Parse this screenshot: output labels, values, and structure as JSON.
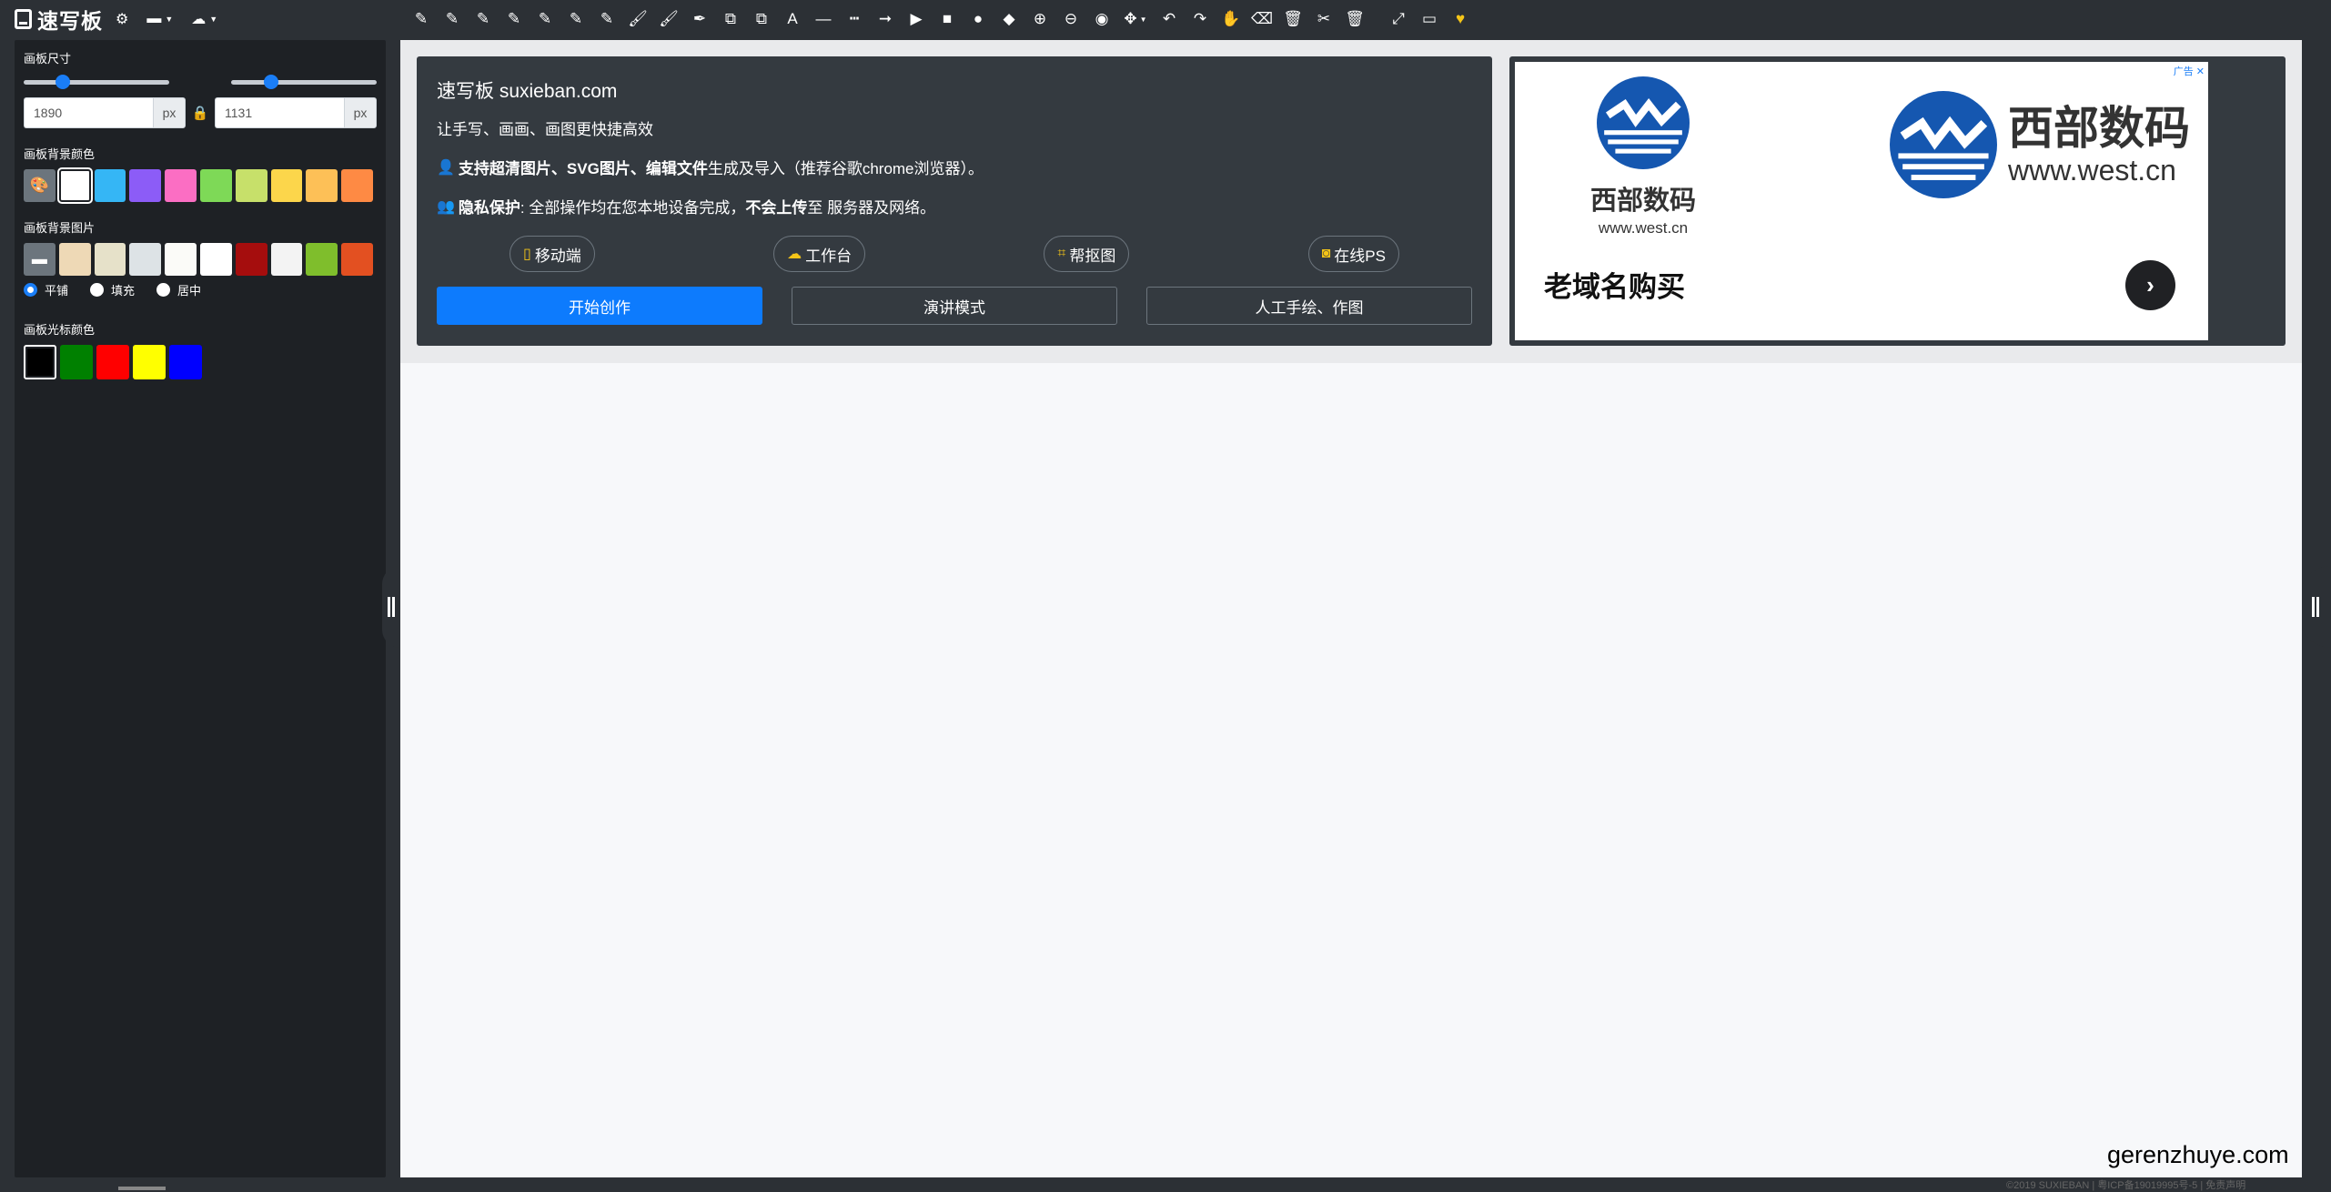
{
  "app": {
    "name": "速写板"
  },
  "top_menu": [
    {
      "icon": "gear-icon",
      "glyph": "⚙",
      "has_caret": false
    },
    {
      "icon": "folder-open-icon",
      "glyph": "▬",
      "has_caret": true
    },
    {
      "icon": "cloud-upload-icon",
      "glyph": "☁",
      "has_caret": true
    }
  ],
  "toolbar": [
    {
      "name": "pencil-1-icon",
      "glyph": "✎"
    },
    {
      "name": "pencil-2-icon",
      "glyph": "✎"
    },
    {
      "name": "pencil-3-icon",
      "glyph": "✎"
    },
    {
      "name": "pencil-4-icon",
      "glyph": "✎"
    },
    {
      "name": "pencil-5-icon",
      "glyph": "✎"
    },
    {
      "name": "pencil-6-icon",
      "glyph": "✎"
    },
    {
      "name": "pencil-7-icon",
      "glyph": "✎"
    },
    {
      "name": "brush-1-icon",
      "glyph": "🖌"
    },
    {
      "name": "brush-2-icon",
      "glyph": "🖌"
    },
    {
      "name": "marker-icon",
      "glyph": "✒"
    },
    {
      "name": "shapes-icon",
      "glyph": "⧉"
    },
    {
      "name": "shapes-alt-icon",
      "glyph": "⧉"
    },
    {
      "name": "text-icon",
      "glyph": "A"
    },
    {
      "name": "line-icon",
      "glyph": "—"
    },
    {
      "name": "dashed-line-icon",
      "glyph": "┅"
    },
    {
      "name": "arrow-line-icon",
      "glyph": "➞"
    },
    {
      "name": "triangle-icon",
      "glyph": "▶"
    },
    {
      "name": "square-icon",
      "glyph": "■"
    },
    {
      "name": "circle-icon",
      "glyph": "●"
    },
    {
      "name": "shapes-group-icon",
      "glyph": "◆"
    },
    {
      "name": "zoom-in-icon",
      "glyph": "⊕"
    },
    {
      "name": "zoom-out-icon",
      "glyph": "⊖"
    },
    {
      "name": "target-icon",
      "glyph": "◉"
    },
    {
      "name": "move-icon",
      "glyph": "✥",
      "caret": true
    },
    {
      "name": "undo-icon",
      "glyph": "↶"
    },
    {
      "name": "redo-icon",
      "glyph": "↷"
    },
    {
      "name": "hand-icon",
      "glyph": "✋"
    },
    {
      "name": "eraser-icon",
      "glyph": "⌫"
    },
    {
      "name": "trash-icon",
      "glyph": "🗑"
    },
    {
      "name": "scissors-icon",
      "glyph": "✂"
    },
    {
      "name": "trash-all-icon",
      "glyph": "🗑"
    },
    {
      "name": "fullscreen-icon",
      "glyph": "⤢",
      "gap": true
    },
    {
      "name": "presentation-icon",
      "glyph": "▭"
    },
    {
      "name": "heart-icon",
      "glyph": "♥",
      "heart": true
    }
  ],
  "left_panel": {
    "size_label": "画板尺寸",
    "width_value": "1890",
    "height_value": "1131",
    "unit": "px",
    "width_slider": 0.24,
    "height_slider": 0.25,
    "bg_color_label": "画板背景颜色",
    "bg_colors": [
      "#ffffff",
      "#35b6f5",
      "#8c5cf7",
      "#fb6ec3",
      "#7ed957",
      "#c7e06a",
      "#fcd64b",
      "#fdc057",
      "#fe8a44"
    ],
    "bg_image_label": "画板背景图片",
    "bg_images": [
      "#eed9b6",
      "#e6e1c9",
      "#dde3e6",
      "#fbfbf8",
      "#ffffff",
      "#a50d0d",
      "#f3f3f3",
      "#7fbe2c",
      "#e35021"
    ],
    "fill_modes": [
      "平铺",
      "填充",
      "居中"
    ],
    "fill_selected": 0,
    "cursor_color_label": "画板光标颜色",
    "cursor_colors": [
      "#000000",
      "#008000",
      "#ff0000",
      "#ffff00",
      "#0000ff"
    ]
  },
  "hero": {
    "title": "速写板 suxieban.com",
    "subtitle": "让手写、画画、画图更快捷高效",
    "line2_bold_1": "支持超清图片、SVG图片、编辑文件",
    "line2_rest": "生成及导入（推荐谷歌chrome浏览器）。",
    "line3_bold_1": "隐私保护",
    "line3_mid": ": 全部操作均在您本地设备完成，",
    "line3_bold_2": "不会上传",
    "line3_rest": " 至 服务器及网络。",
    "pills": [
      {
        "label": "移动端",
        "icon": "tablet-icon",
        "glyph": "▯"
      },
      {
        "label": "工作台",
        "icon": "cloud-icon",
        "glyph": "☁"
      },
      {
        "label": "帮抠图",
        "icon": "crop-icon",
        "glyph": "⌗"
      },
      {
        "label": "在线PS",
        "icon": "camera-icon",
        "glyph": "◙"
      }
    ],
    "buttons": [
      "开始创作",
      "演讲模式",
      "人工手绘、作图"
    ]
  },
  "ad": {
    "tag": "广告 ✕",
    "brand_cn": "西部数码",
    "brand_url": "www.west.cn",
    "headline": "老域名购买",
    "arrow": "›"
  },
  "watermark": "gerenzhuye.com",
  "footer": "©2019 SUXIEBAN | 粤ICP备19019995号-5 | 免责声明"
}
